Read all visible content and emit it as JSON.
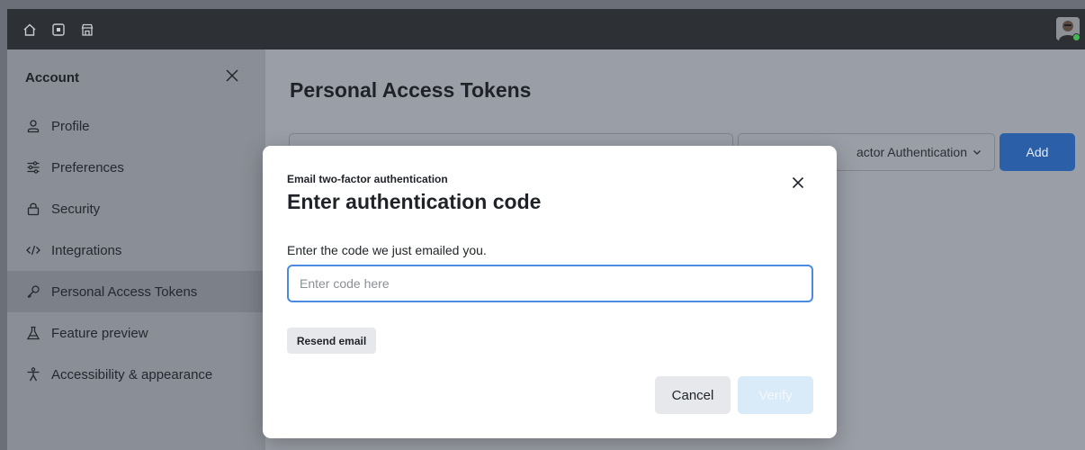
{
  "topbar": {
    "icons": [
      "home-icon",
      "dashboard-icon",
      "store-icon"
    ],
    "avatar_status_color": "#3fb950"
  },
  "sidebar": {
    "title": "Account",
    "items": [
      {
        "label": "Profile",
        "icon": "person-icon"
      },
      {
        "label": "Preferences",
        "icon": "sliders-icon"
      },
      {
        "label": "Security",
        "icon": "lock-icon"
      },
      {
        "label": "Integrations",
        "icon": "code-icon"
      },
      {
        "label": "Personal Access Tokens",
        "icon": "key-icon",
        "active": true
      },
      {
        "label": "Feature preview",
        "icon": "flask-icon"
      },
      {
        "label": "Accessibility & appearance",
        "icon": "accessibility-icon"
      }
    ]
  },
  "main": {
    "title": "Personal Access Tokens",
    "select_value": "actor Authentication",
    "add_label": "Add"
  },
  "modal": {
    "kicker": "Email two-factor authentication",
    "title": "Enter authentication code",
    "input_label": "Enter the code we just emailed you.",
    "input_placeholder": "Enter code here",
    "input_value": "",
    "resend_label": "Resend email",
    "cancel_label": "Cancel",
    "verify_label": "Verify"
  },
  "colors": {
    "primary": "#2b5fa8",
    "focus_border": "#4a8ae0",
    "verify_disabled_bg": "#d9eaf9"
  }
}
